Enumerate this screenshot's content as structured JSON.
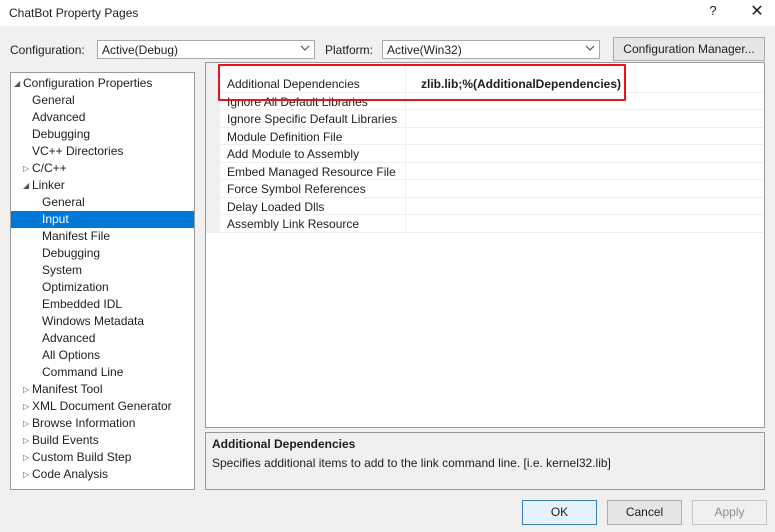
{
  "window": {
    "title": "ChatBot Property Pages",
    "help_glyph": "?",
    "close_glyph": "✕"
  },
  "toolbar": {
    "configuration_label": "Configuration:",
    "configuration_value": "Active(Debug)",
    "platform_label": "Platform:",
    "platform_value": "Active(Win32)",
    "config_manager_label": "Configuration Manager..."
  },
  "tree": {
    "items": [
      {
        "label": "Configuration Properties",
        "arrow": "◢"
      },
      {
        "label": "General"
      },
      {
        "label": "Advanced"
      },
      {
        "label": "Debugging"
      },
      {
        "label": "VC++ Directories"
      },
      {
        "label": "C/C++",
        "arrow": "▷"
      },
      {
        "label": "Linker",
        "arrow": "◢"
      },
      {
        "label": "General"
      },
      {
        "label": "Input",
        "selected": true
      },
      {
        "label": "Manifest File"
      },
      {
        "label": "Debugging"
      },
      {
        "label": "System"
      },
      {
        "label": "Optimization"
      },
      {
        "label": "Embedded IDL"
      },
      {
        "label": "Windows Metadata"
      },
      {
        "label": "Advanced"
      },
      {
        "label": "All Options"
      },
      {
        "label": "Command Line"
      },
      {
        "label": "Manifest Tool",
        "arrow": "▷"
      },
      {
        "label": "XML Document Generator",
        "arrow": "▷"
      },
      {
        "label": "Browse Information",
        "arrow": "▷"
      },
      {
        "label": "Build Events",
        "arrow": "▷"
      },
      {
        "label": "Custom Build Step",
        "arrow": "▷"
      },
      {
        "label": "Code Analysis",
        "arrow": "▷"
      }
    ]
  },
  "grid": {
    "rows": [
      {
        "name": "Additional Dependencies",
        "value": "zlib.lib;%(AdditionalDependencies)"
      },
      {
        "name": "Ignore All Default Libraries",
        "value": ""
      },
      {
        "name": "Ignore Specific Default Libraries",
        "value": ""
      },
      {
        "name": "Module Definition File",
        "value": ""
      },
      {
        "name": "Add Module to Assembly",
        "value": ""
      },
      {
        "name": "Embed Managed Resource File",
        "value": ""
      },
      {
        "name": "Force Symbol References",
        "value": ""
      },
      {
        "name": "Delay Loaded Dlls",
        "value": ""
      },
      {
        "name": "Assembly Link Resource",
        "value": ""
      }
    ]
  },
  "description": {
    "title": "Additional Dependencies",
    "text": "Specifies additional items to add to the link command line. [i.e. kernel32.lib]"
  },
  "buttons": {
    "ok": "OK",
    "cancel": "Cancel",
    "apply": "Apply"
  },
  "colors": {
    "selection": "#0078d7",
    "highlight_box": "#e8141b"
  }
}
